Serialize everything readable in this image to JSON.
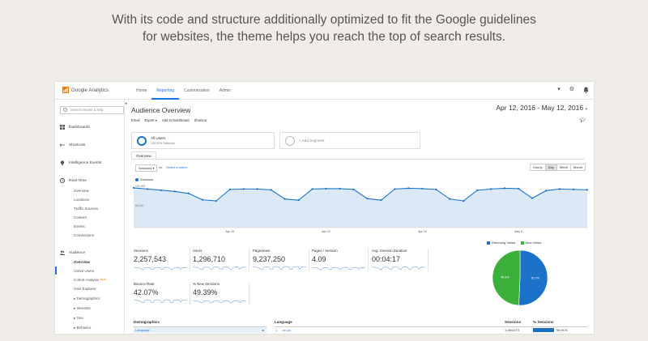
{
  "headline": {
    "line1": "With its code and structure additionally optimized to fit the Google guidelines",
    "line2": "for websites, the theme helps you reach the top of search results."
  },
  "app": {
    "name": "Google Analytics",
    "nav": [
      "Home",
      "Reporting",
      "Customization",
      "Admin"
    ],
    "active_nav": "Reporting"
  },
  "icons": {
    "logo": "analytics-logo-icon",
    "dropdown": "chevron-down-icon",
    "settings": "gear-icon",
    "notifications": "bell-icon",
    "share": "graduation-cap-icon"
  },
  "sidebar": {
    "search_placeholder": "Search reports & help",
    "items": [
      {
        "label": "Dashboards",
        "icon": "grid-icon"
      },
      {
        "label": "Shortcuts",
        "icon": "arrows-icon"
      },
      {
        "label": "Intelligence Events",
        "icon": "lightbulb-icon"
      },
      {
        "label": "Real-Time",
        "icon": "clock-icon"
      }
    ],
    "realtime_sub": [
      "Overview",
      "Locations",
      "Traffic Sources",
      "Content",
      "Events",
      "Conversions"
    ],
    "audience": {
      "label": "Audience",
      "icon": "people-icon"
    },
    "audience_sub": [
      "Overview",
      "Active Users",
      "Cohort Analysis",
      "User Explorer",
      "▸ Demographics",
      "▸ Interests",
      "▸ Geo",
      "▸ Behavior"
    ],
    "beta_badge": "BETA"
  },
  "report": {
    "title": "Audience Overview",
    "date_range": "Apr 12, 2016 - May 12, 2016",
    "date_caret": "▾",
    "actions": [
      "Email",
      "Export ▾",
      "Add to Dashboard",
      "Shortcut"
    ],
    "segments": [
      {
        "name": "All Users",
        "sub": "100.00% Sessions"
      },
      {
        "name": "+ Add Segment",
        "sub": ""
      }
    ],
    "tab": "Overview",
    "metric_select": "Sessions ▾",
    "vs": "vs.",
    "select_metric": "Select a metric",
    "granularity": [
      "Hourly",
      "Day",
      "Week",
      "Month"
    ],
    "granularity_selected": "Day",
    "series_legend": "Sessions",
    "collapse": "◂"
  },
  "chart_data": {
    "type": "area",
    "series": [
      {
        "name": "Sessions",
        "values": [
          100000,
          97000,
          94000,
          91000,
          86000,
          70000,
          67000,
          96000,
          97000,
          97000,
          95000,
          72000,
          69000,
          97000,
          98000,
          98000,
          96000,
          73000,
          69000,
          97000,
          99000,
          98000,
          96000,
          72000,
          67000,
          94000,
          97000,
          99000,
          98000,
          74000,
          93000,
          97000,
          96000,
          95000
        ]
      }
    ],
    "yticks": [
      "100,000",
      "50,000"
    ],
    "ylim": [
      0,
      110000
    ],
    "xticks": [
      "Apr 15",
      "Apr 22",
      "Apr 29",
      "May 6"
    ],
    "color": "#1a73c8",
    "fill": "#dbe9f7"
  },
  "metrics": [
    {
      "label": "Sessions",
      "value": "2,257,543"
    },
    {
      "label": "Users",
      "value": "1,296,710"
    },
    {
      "label": "Pageviews",
      "value": "9,237,250"
    },
    {
      "label": "Pages / Session",
      "value": "4.09"
    },
    {
      "label": "Avg. Session Duration",
      "value": "00:04:17"
    },
    {
      "label": "Bounce Rate",
      "value": "42.07%"
    },
    {
      "label": "% New Sessions",
      "value": "49.39%"
    }
  ],
  "pie": {
    "legend": [
      {
        "label": "Returning Visitor",
        "color": "#1a73c8"
      },
      {
        "label": "New Visitor",
        "color": "#3bb03b"
      }
    ],
    "slices": [
      {
        "label": "Returning Visitor",
        "value": 50.7,
        "color": "#1a73c8",
        "text": "50.7%"
      },
      {
        "label": "New Visitor",
        "value": 49.3,
        "color": "#3bb03b",
        "text": "49.3%"
      }
    ]
  },
  "tables": {
    "demographics_header": "Demographics",
    "demographics_row": "Language",
    "language_header": "Language",
    "sessions_header": "Sessions",
    "pct_header": "% Sessions",
    "row1_index": "1.",
    "row1_lang": "en-us",
    "row1_sessions": "1,284,673",
    "row1_pct": "56.91%",
    "row1_pct_value": 56.91
  }
}
